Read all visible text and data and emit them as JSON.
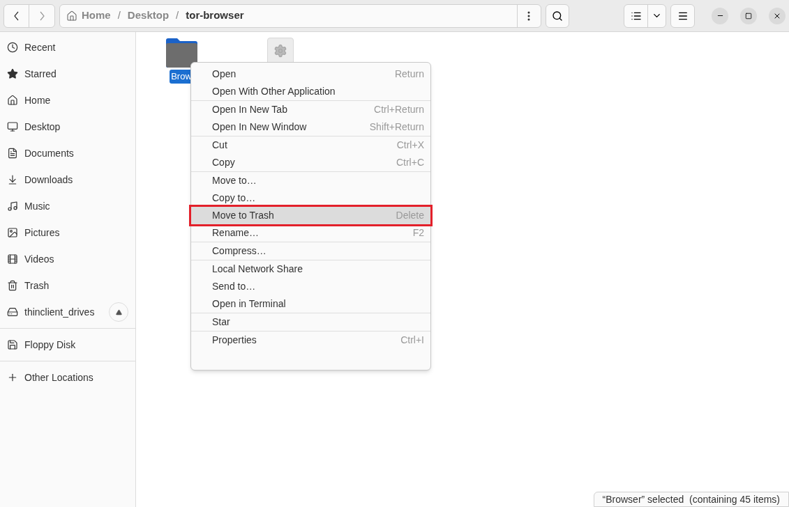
{
  "path": [
    {
      "label": "Home",
      "current": false
    },
    {
      "separator": "/",
      "label": "Desktop",
      "current": false
    },
    {
      "separator": "/",
      "label": "tor-browser",
      "current": true
    }
  ],
  "sidebar": {
    "sections": [
      [
        {
          "label": "Recent",
          "ejectable": false
        },
        {
          "label": "Starred",
          "ejectable": false
        },
        {
          "label": "Home",
          "ejectable": false
        },
        {
          "label": "Desktop",
          "ejectable": false
        },
        {
          "label": "Documents",
          "ejectable": false
        },
        {
          "label": "Downloads",
          "ejectable": false
        },
        {
          "label": "Music",
          "ejectable": false
        },
        {
          "label": "Pictures",
          "ejectable": false
        },
        {
          "label": "Videos",
          "ejectable": false
        },
        {
          "label": "Trash",
          "ejectable": false
        },
        {
          "label": "thinclient_drives",
          "ejectable": true
        }
      ],
      [
        {
          "label": "Floppy Disk",
          "ejectable": false
        }
      ],
      [
        {
          "label": "Other Locations",
          "ejectable": false
        }
      ]
    ]
  },
  "files": [
    {
      "kind": "folder",
      "name": "Brow",
      "selected": true
    },
    {
      "kind": "executable",
      "selected": false
    }
  ],
  "context_menu": {
    "groups": [
      [
        {
          "label": "Open",
          "shortcut": "Return",
          "selected": false,
          "outlined": false
        },
        {
          "label": "Open With Other Application",
          "selected": false,
          "outlined": false
        }
      ],
      [
        {
          "label": "Open In New Tab",
          "shortcut": "Ctrl+Return",
          "selected": false,
          "outlined": false
        },
        {
          "label": "Open In New Window",
          "shortcut": "Shift+Return",
          "selected": false,
          "outlined": false
        }
      ],
      [
        {
          "label": "Cut",
          "shortcut": "Ctrl+X",
          "selected": false,
          "outlined": false
        },
        {
          "label": "Copy",
          "shortcut": "Ctrl+C",
          "selected": false,
          "outlined": false
        }
      ],
      [
        {
          "label": "Move to…",
          "selected": false,
          "outlined": false
        },
        {
          "label": "Copy to…",
          "selected": false,
          "outlined": false
        },
        {
          "label": "Move to Trash",
          "shortcut": "Delete",
          "selected": true,
          "outlined": true
        },
        {
          "label": "Rename…",
          "shortcut": "F2",
          "selected": false,
          "outlined": false
        }
      ],
      [
        {
          "label": "Compress…",
          "selected": false,
          "outlined": false
        }
      ],
      [
        {
          "label": "Local Network Share",
          "selected": false,
          "outlined": false
        },
        {
          "label": "Send to…",
          "selected": false,
          "outlined": false
        },
        {
          "label": "Open in Terminal",
          "selected": false,
          "outlined": false
        }
      ],
      [
        {
          "label": "Star",
          "selected": false,
          "outlined": false
        }
      ],
      [
        {
          "label": "Properties",
          "shortcut": "Ctrl+I",
          "selected": false,
          "outlined": false
        }
      ]
    ]
  },
  "status_bar": "“Browser” selected  (containing 45 items)"
}
